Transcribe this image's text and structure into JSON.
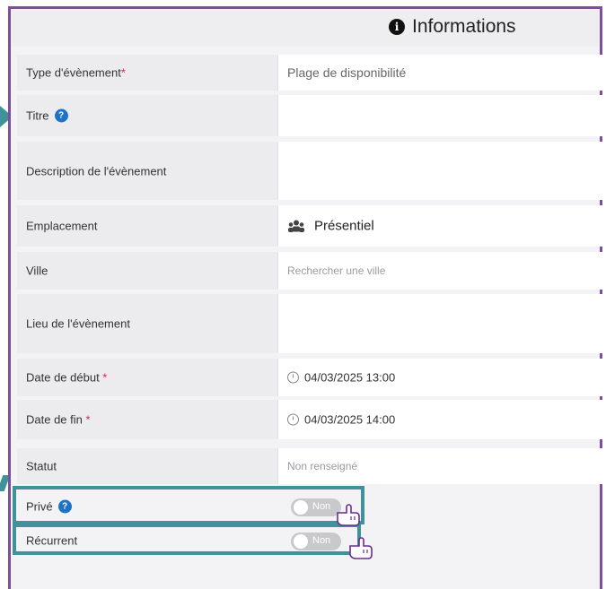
{
  "header": {
    "title": "Informations",
    "icon": "info-icon"
  },
  "fields": {
    "type": {
      "label": "Type d'évènement",
      "required": "*",
      "value": "Plage de disponibilité"
    },
    "titre": {
      "label": "Titre",
      "help_icon": "?"
    },
    "description": {
      "label": "Description de l'évènement"
    },
    "emplacement": {
      "label": "Emplacement",
      "value": "Présentiel",
      "icon": "people-icon"
    },
    "ville": {
      "label": "Ville",
      "placeholder": "Rechercher une ville"
    },
    "lieu": {
      "label": "Lieu de l'évènement"
    },
    "date_debut": {
      "label": "Date de début ",
      "required": "*",
      "value": "04/03/2025 13:00"
    },
    "date_fin": {
      "label": "Date de fin ",
      "required": "*",
      "value": "04/03/2025 14:00"
    },
    "statut": {
      "label": "Statut",
      "placeholder": "Non renseigné"
    },
    "prive": {
      "label": "Privé",
      "help_icon": "?",
      "toggle": "Non"
    },
    "recurrent": {
      "label": "Récurrent",
      "toggle": "Non"
    }
  },
  "colors": {
    "frame": "#7d4e9b",
    "highlight": "#3f9299",
    "help": "#1e73c8",
    "required": "#e0245e"
  }
}
